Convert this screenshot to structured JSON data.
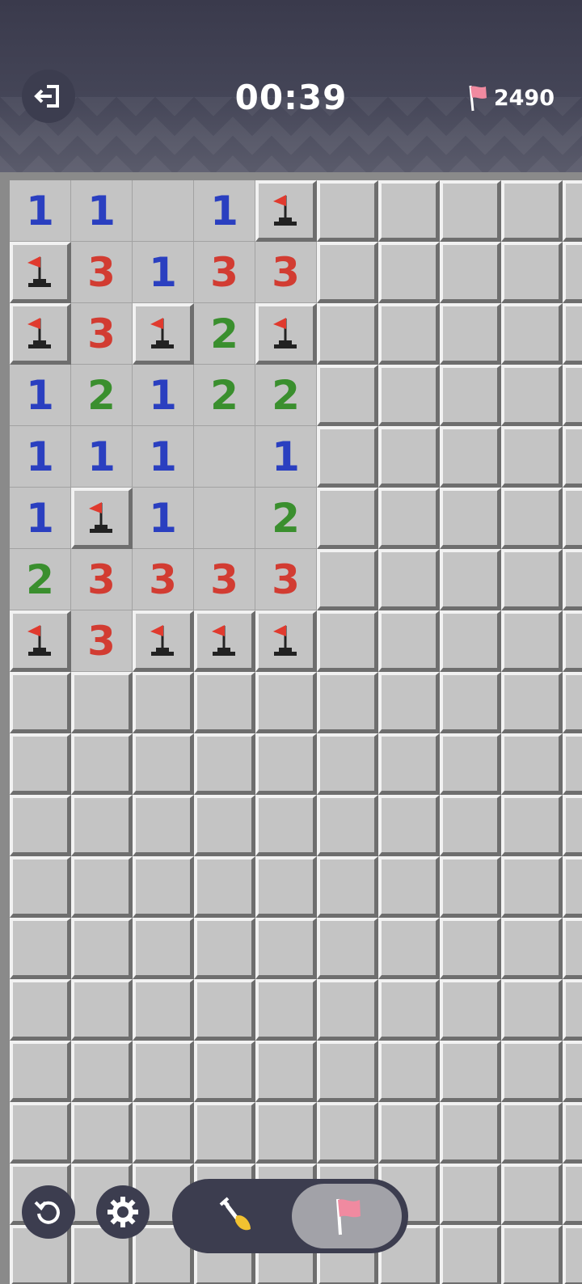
{
  "header": {
    "timer": "00:39",
    "flag_count": "2490",
    "exit_icon": "exit-icon",
    "flag_icon": "flag-icon"
  },
  "board": {
    "columns": 10,
    "rows": 18,
    "revealed": [
      [
        "1",
        "1",
        "",
        "1",
        "F"
      ],
      [
        "F",
        "3",
        "1",
        "3",
        "3"
      ],
      [
        "F",
        "3",
        "F",
        "2",
        "F"
      ],
      [
        "1",
        "2",
        "1",
        "2",
        "2"
      ],
      [
        "1",
        "1",
        "1",
        "",
        "1"
      ],
      [
        "1",
        "F",
        "1",
        "",
        "2"
      ],
      [
        "2",
        "3",
        "3",
        "3",
        "3"
      ],
      [
        "F",
        "3",
        "F",
        "F",
        "F"
      ]
    ],
    "number_colors": {
      "1": "#2a3fc0",
      "2": "#3a8f2e",
      "3": "#d23c32"
    }
  },
  "controls": {
    "restart_icon": "restart-icon",
    "settings_icon": "gear-icon",
    "dig_icon": "shovel-icon",
    "flag_mode_icon": "flag-icon",
    "active_mode": "flag"
  }
}
